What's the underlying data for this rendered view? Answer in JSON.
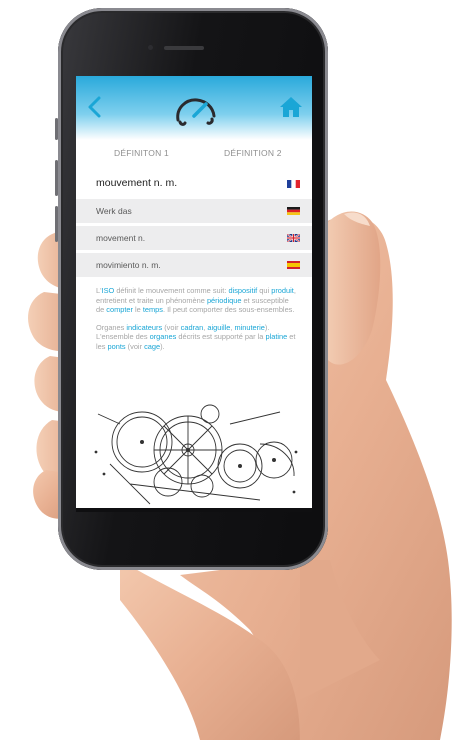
{
  "header": {
    "back_icon": "chevron-left-icon",
    "logo_icon": "gauge-logo-icon",
    "home_icon": "home-icon",
    "accent": "#1aa6d6"
  },
  "tabs": [
    {
      "label": "DÉFINITON 1"
    },
    {
      "label": "DÉFINITION 2"
    }
  ],
  "term": {
    "label": "mouvement n. m.",
    "flag": "france-flag-icon"
  },
  "translations": [
    {
      "label": "Werk das",
      "flag": "germany-flag-icon"
    },
    {
      "label": "movement n.",
      "flag": "uk-flag-icon"
    },
    {
      "label": "movimiento n. m.",
      "flag": "spain-flag-icon"
    }
  ],
  "definition": {
    "p1": [
      {
        "text": "L'",
        "hl": false
      },
      {
        "text": "ISO",
        "hl": true
      },
      {
        "text": " définit le mouvement comme suit: ",
        "hl": false
      },
      {
        "text": "dispositif",
        "hl": true
      },
      {
        "text": " qui ",
        "hl": false
      },
      {
        "text": "produit",
        "hl": true
      },
      {
        "text": ", entretient et traite un phénomène ",
        "hl": false
      },
      {
        "text": "périodique",
        "hl": true
      },
      {
        "text": " et susceptible de ",
        "hl": false
      },
      {
        "text": "compter",
        "hl": true
      },
      {
        "text": " le ",
        "hl": false
      },
      {
        "text": "temps",
        "hl": true
      },
      {
        "text": ". Il peut comporter des sous-ensembles.",
        "hl": false
      }
    ],
    "p2": [
      {
        "text": "Organes ",
        "hl": false
      },
      {
        "text": "indicateurs",
        "hl": true
      },
      {
        "text": " (voir ",
        "hl": false
      },
      {
        "text": "cadran",
        "hl": true
      },
      {
        "text": ", ",
        "hl": false
      },
      {
        "text": "aiguille",
        "hl": true
      },
      {
        "text": ", ",
        "hl": false
      },
      {
        "text": "minuterie",
        "hl": true
      },
      {
        "text": "). L'ensemble des ",
        "hl": false
      },
      {
        "text": "organes",
        "hl": true
      },
      {
        "text": " décrits est supporté par la ",
        "hl": false
      },
      {
        "text": "platine",
        "hl": true
      },
      {
        "text": " et les ",
        "hl": false
      },
      {
        "text": "ponts",
        "hl": true
      },
      {
        "text": " (voir ",
        "hl": false
      },
      {
        "text": "cage",
        "hl": true
      },
      {
        "text": ").",
        "hl": false
      }
    ]
  },
  "illustration": {
    "icon": "watch-movement-engraving-icon"
  }
}
